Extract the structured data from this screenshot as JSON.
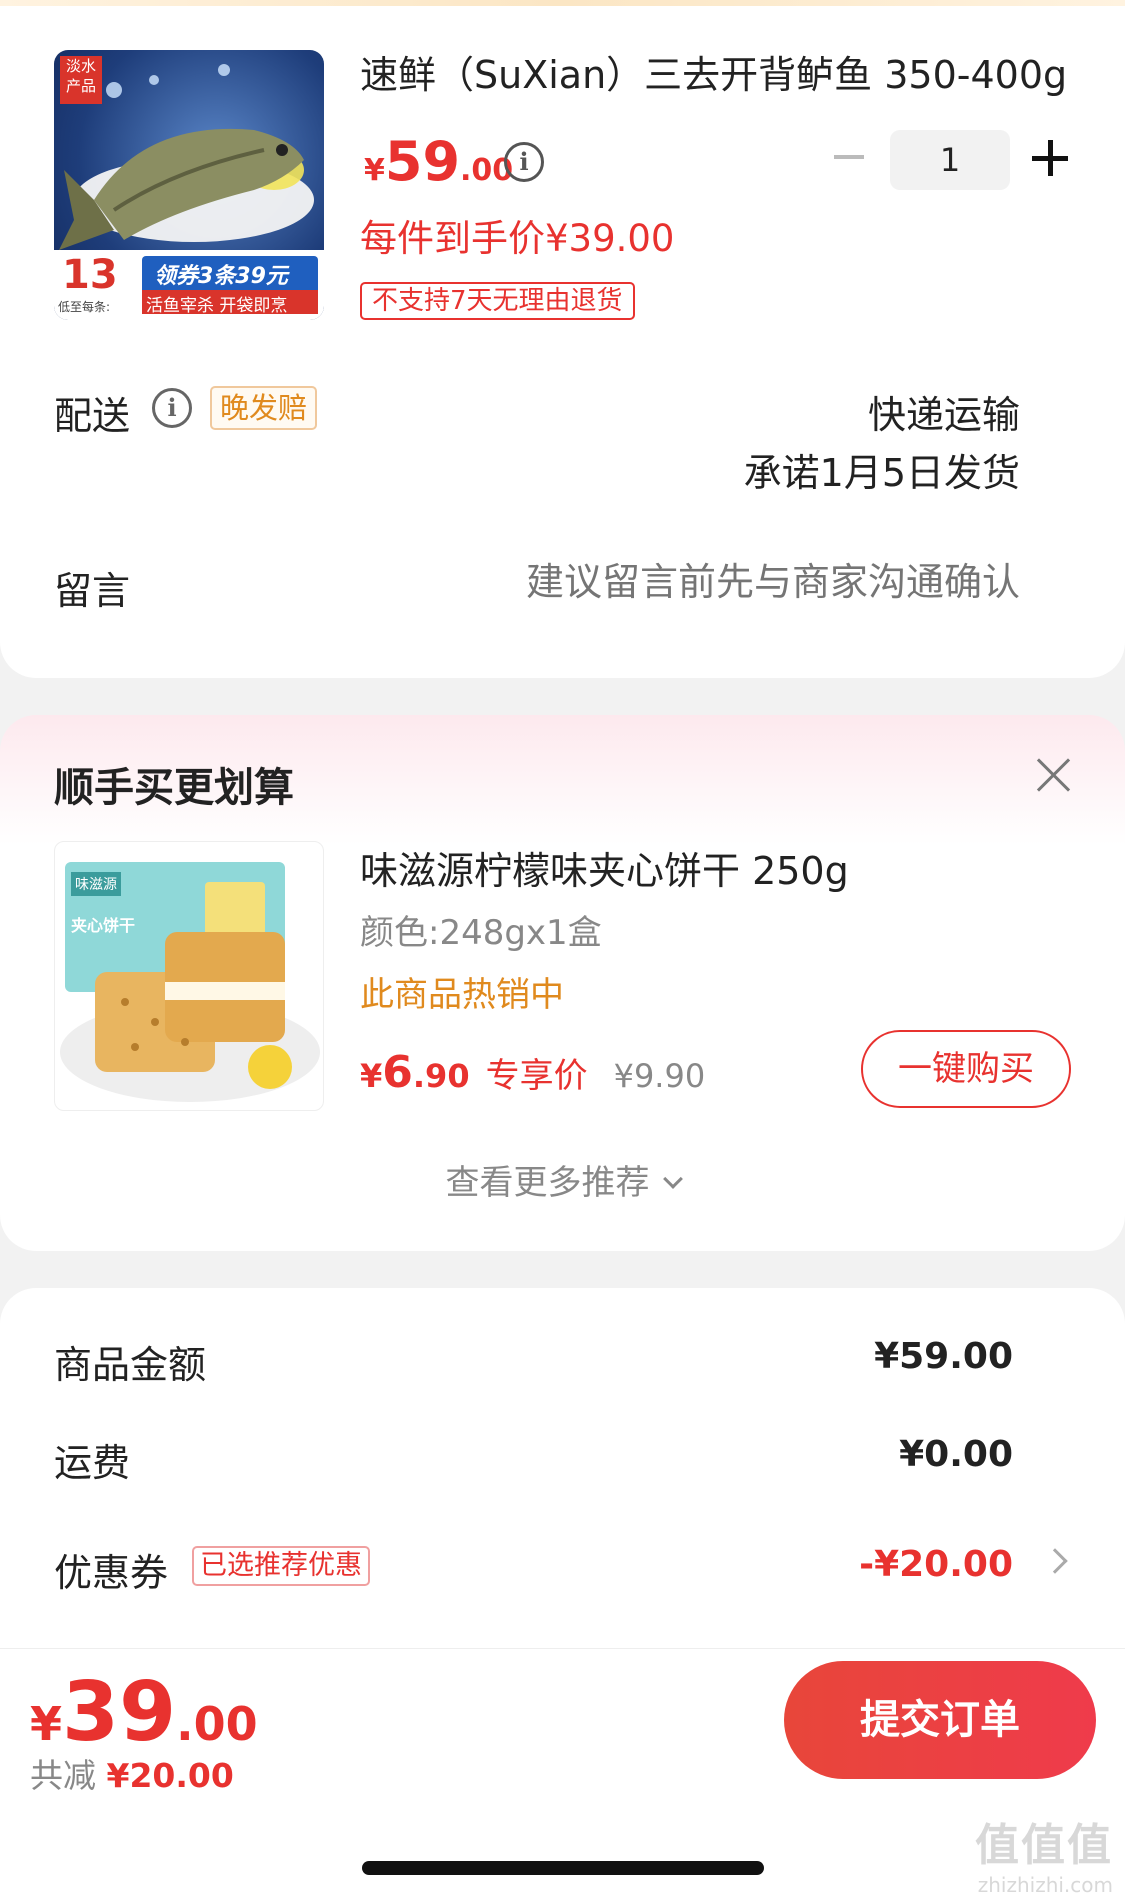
{
  "product": {
    "title": "速鲜（SuXian）三去开背鲈鱼 350-400g",
    "price_symbol": "¥",
    "price_int": "59",
    "price_dec": ".00",
    "unit_price": "每件到手价¥39.00",
    "no_return_tag": "不支持7天无理由退货",
    "quantity": "1",
    "image_badge": "淡水产品",
    "image_banner_num": "13",
    "image_banner_top": "领券3条39元",
    "image_banner_bottom": "活鱼宰杀 开袋即烹",
    "image_banner_side": "低至每条:",
    "info_icon": "info-icon"
  },
  "delivery": {
    "label": "配送",
    "late_tag": "晚发赔",
    "method": "快递运输",
    "promise": "承诺1月5日发货"
  },
  "message": {
    "label": "留言",
    "placeholder": "建议留言前先与商家沟通确认"
  },
  "recommend": {
    "title": "顺手买更划算",
    "item_name": "味滋源柠檬味夹心饼干 250g",
    "item_spec": "颜色:248gx1盒",
    "item_hot": "此商品热销中",
    "price_symbol": "¥",
    "price_int": "6",
    "price_dec": ".90",
    "price_label": "专享价",
    "orig_price": "¥9.90",
    "buy_button": "一键购买",
    "more": "查看更多推荐",
    "box_brand": "味滋源",
    "box_text": "夹心饼干"
  },
  "summary": {
    "goods_label": "商品金额",
    "goods_value": "¥59.00",
    "shipping_label": "运费",
    "shipping_value": "¥0.00",
    "coupon_label": "优惠券",
    "coupon_tag": "已选推荐优惠",
    "coupon_value": "-¥20.00"
  },
  "bottom": {
    "total_symbol": "¥",
    "total_int": "39",
    "total_dec": ".00",
    "saved_label": "共减",
    "saved_amount": "¥20.00",
    "submit": "提交订单",
    "watermark_big": "值值值",
    "watermark_small": "zhizhizhi.com"
  },
  "colors": {
    "accent": "#e8322f",
    "orange": "#e08a1e",
    "background": "#f2f2f2"
  }
}
